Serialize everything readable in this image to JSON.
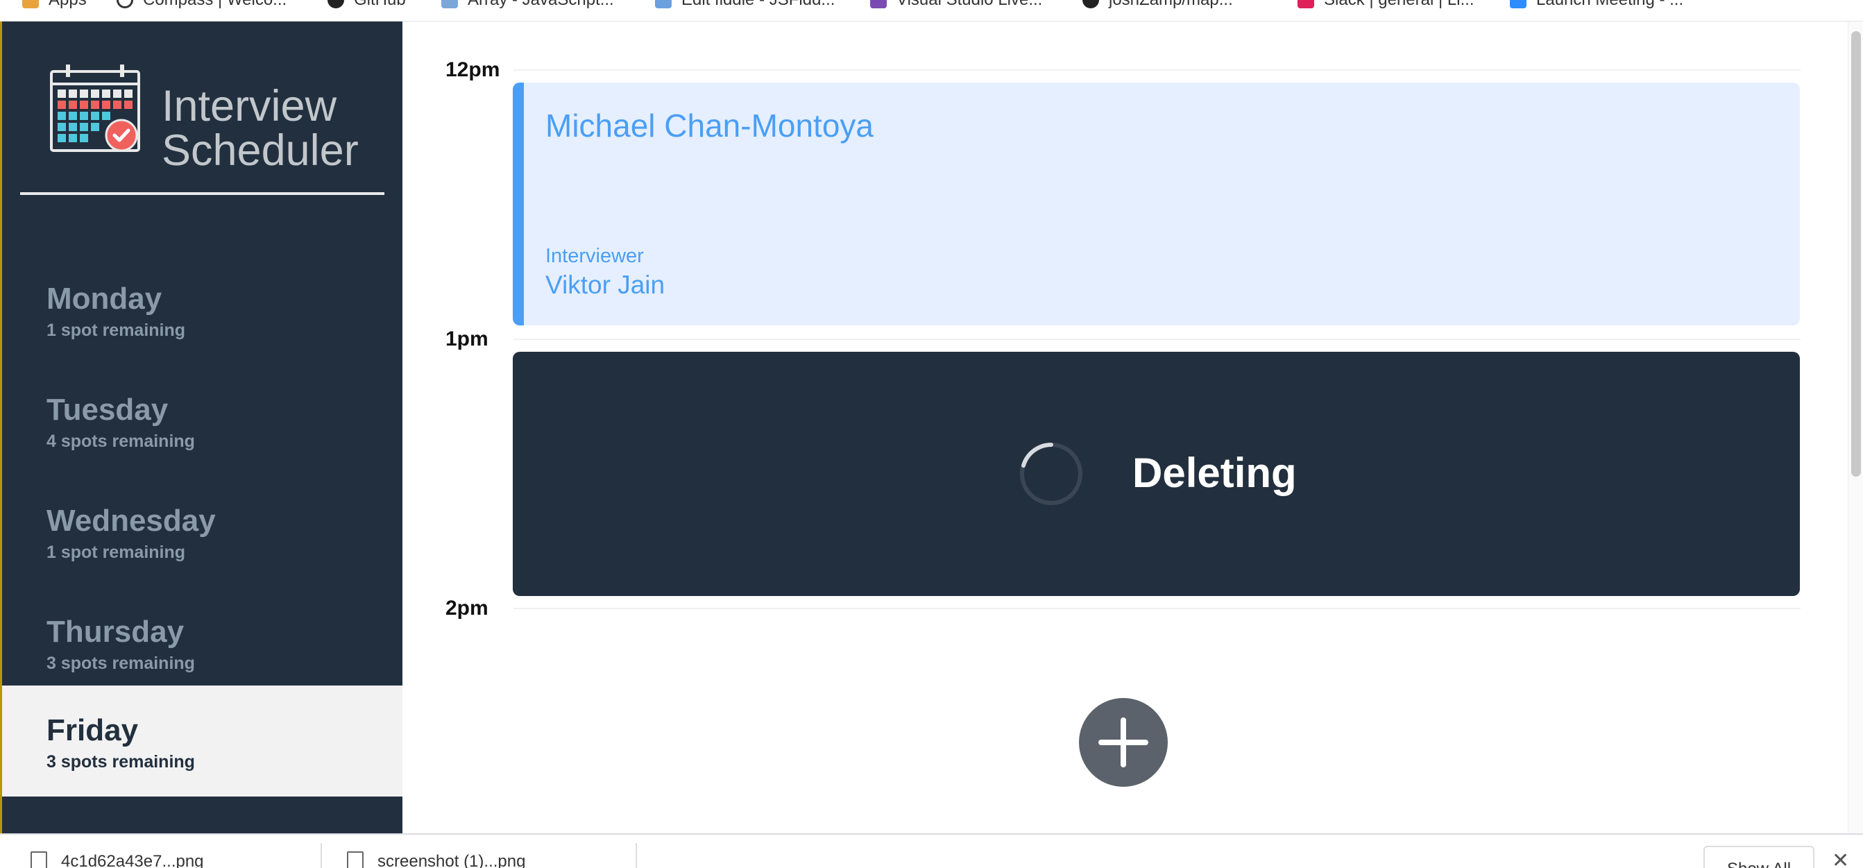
{
  "bookmarks": [
    {
      "label": "Apps",
      "icon": "apps-grid-icon",
      "color": "#e8a33d"
    },
    {
      "label": "Compass | Welco...",
      "icon": "compass-icon",
      "color": "#333333"
    },
    {
      "label": "GitHub",
      "icon": "github-icon",
      "color": "#222222"
    },
    {
      "label": "Array - JavaScript...",
      "icon": "mdn-icon",
      "color": "#7aa7d8"
    },
    {
      "label": "Edit fiddle - JSFidd...",
      "icon": "jsfiddle-icon",
      "color": "#6aa0e0"
    },
    {
      "label": "Visual Studio Live...",
      "icon": "vs-live-icon",
      "color": "#7a4bb0"
    },
    {
      "label": "joshZamp/map...",
      "icon": "github-icon",
      "color": "#222222"
    },
    {
      "label": "Slack | general | Li...",
      "icon": "slack-icon",
      "color": "#e01e5a"
    },
    {
      "label": "Launch Meeting - ...",
      "icon": "zoom-icon",
      "color": "#2d8cff"
    }
  ],
  "app": {
    "title_line1": "Interview",
    "title_line2": "Scheduler"
  },
  "days": [
    {
      "name": "Monday",
      "spots": "1 spot remaining",
      "selected": false
    },
    {
      "name": "Tuesday",
      "spots": "4 spots remaining",
      "selected": false
    },
    {
      "name": "Wednesday",
      "spots": "1 spot remaining",
      "selected": false
    },
    {
      "name": "Thursday",
      "spots": "3 spots remaining",
      "selected": false
    },
    {
      "name": "Friday",
      "spots": "3 spots remaining",
      "selected": true
    }
  ],
  "schedule": {
    "times": [
      "12pm",
      "1pm",
      "2pm"
    ],
    "appointment": {
      "student": "Michael Chan-Montoya",
      "interviewer_label": "Interviewer",
      "interviewer": "Viktor Jain"
    },
    "status_message": "Deleting"
  },
  "downloads": [
    {
      "name": "4c1d62a43e7...png"
    },
    {
      "name": "screenshot (1)...png"
    }
  ],
  "shelf": {
    "show_all_label": "Show All",
    "close_glyph": "✕"
  },
  "colors": {
    "sidebar": "#222f3e",
    "accent": "#4a9ff5",
    "appointment_bg": "#e6efff",
    "add_button": "#5c626b"
  }
}
